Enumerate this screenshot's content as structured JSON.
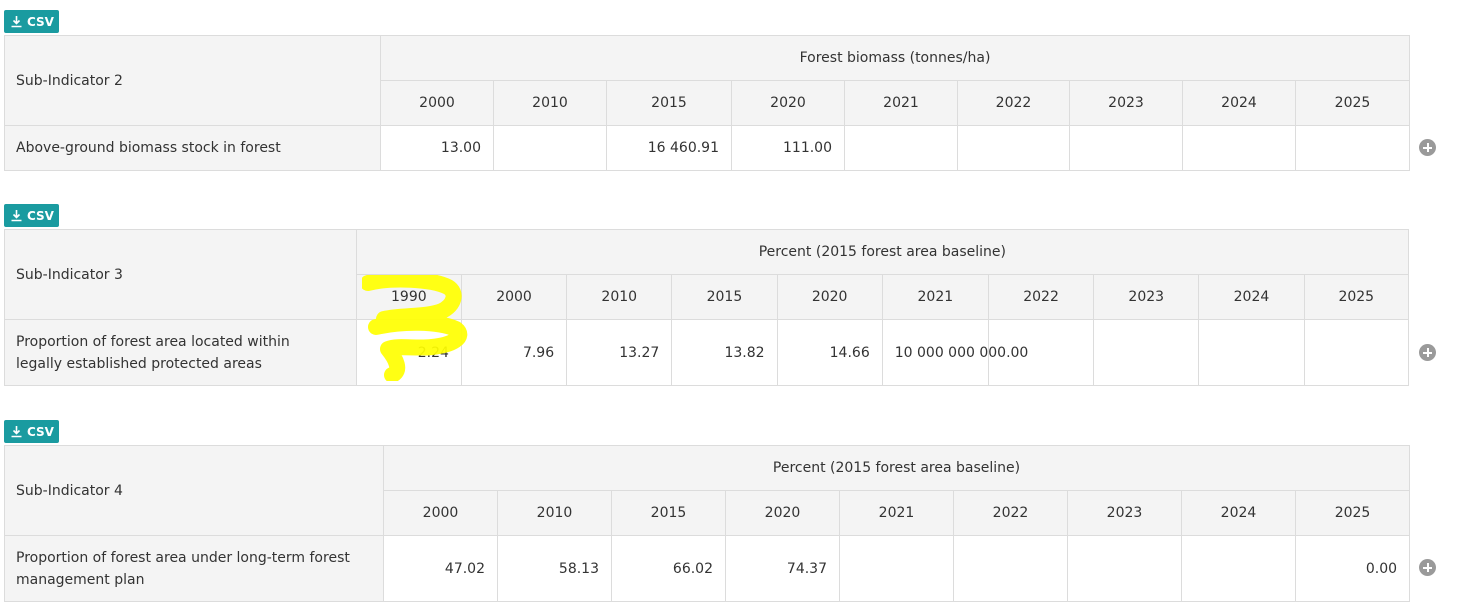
{
  "csv_label": "CSV",
  "tables": [
    {
      "sub_indicator": "Sub-Indicator 2",
      "unit_header": "Forest biomass (tonnes/ha)",
      "years": [
        "2000",
        "2010",
        "2015",
        "2020",
        "2021",
        "2022",
        "2023",
        "2024",
        "2025"
      ],
      "row_label": "Above-ground biomass stock in forest",
      "values": [
        "13.00",
        "",
        "16 460.91",
        "111.00",
        "",
        "",
        "",
        "",
        ""
      ]
    },
    {
      "sub_indicator": "Sub-Indicator 3",
      "unit_header": "Percent (2015 forest area baseline)",
      "years": [
        "1990",
        "2000",
        "2010",
        "2015",
        "2020",
        "2021",
        "2022",
        "2023",
        "2024",
        "2025"
      ],
      "row_label": "Proportion of forest area located within legally established protected areas",
      "values": [
        "2.24",
        "7.96",
        "13.27",
        "13.82",
        "14.66",
        "10 000 000 000.00",
        "",
        "",
        "",
        ""
      ]
    },
    {
      "sub_indicator": "Sub-Indicator 4",
      "unit_header": "Percent (2015 forest area baseline)",
      "years": [
        "2000",
        "2010",
        "2015",
        "2020",
        "2021",
        "2022",
        "2023",
        "2024",
        "2025"
      ],
      "row_label": "Proportion of forest area under long-term forest management plan",
      "values": [
        "47.02",
        "58.13",
        "66.02",
        "74.37",
        "",
        "",
        "",
        "",
        "0.00"
      ]
    }
  ],
  "icons": {
    "download": "download-icon",
    "add": "plus-circle-icon"
  },
  "colors": {
    "csv_button": "#1a9ba0",
    "header_bg": "#f4f4f4",
    "border": "#dcdcdc",
    "highlight_scribble": "#ffff00"
  }
}
